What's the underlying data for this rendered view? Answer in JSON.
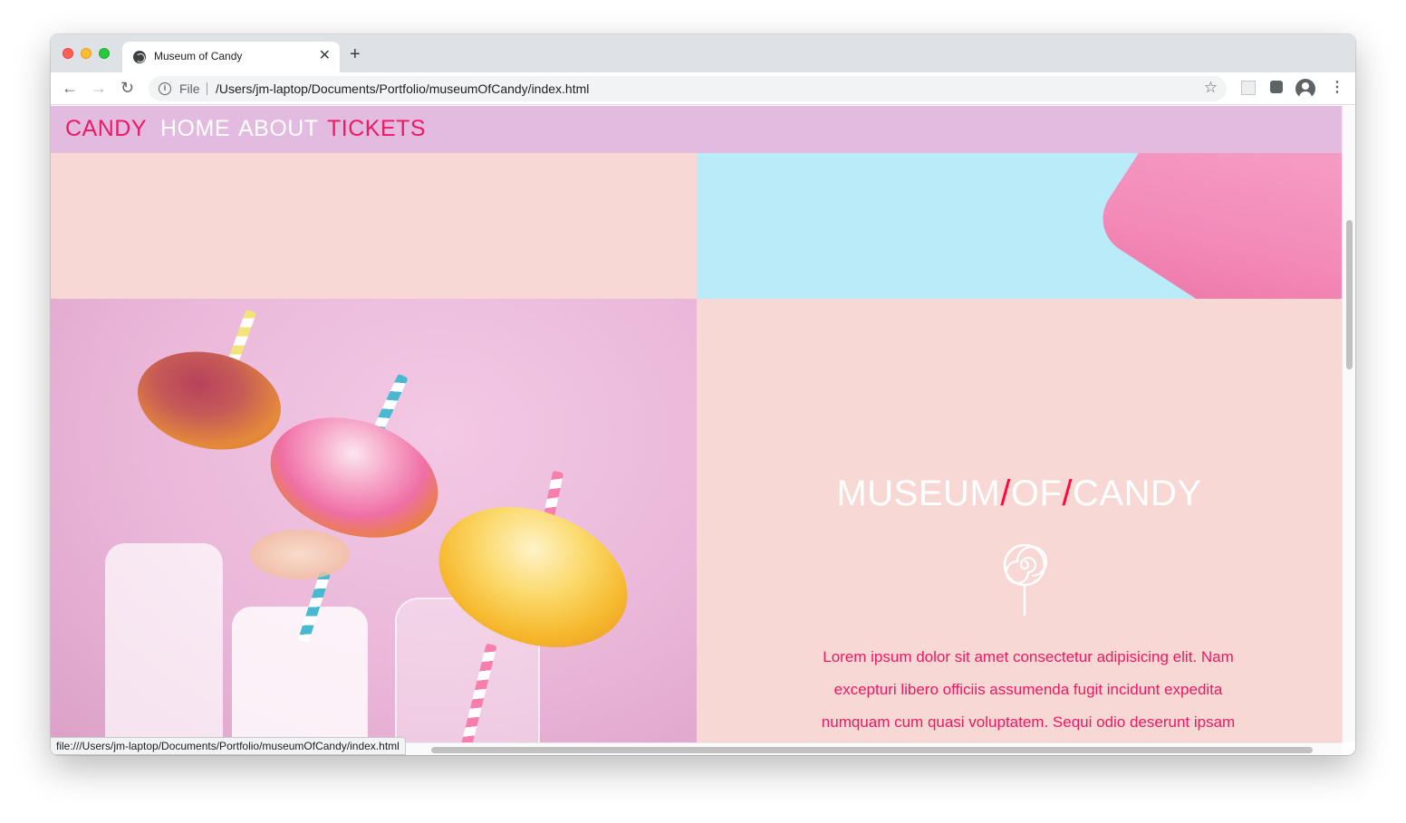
{
  "browser": {
    "tab_title": "Museum of Candy",
    "tab_close": "✕",
    "new_tab": "+",
    "back": "←",
    "forward": "→",
    "reload": "↻",
    "scheme_label": "File",
    "url": "/Users/jm-laptop/Documents/Portfolio/museumOfCandy/index.html",
    "star": "☆",
    "menu": "⋮",
    "status_url": "file:///Users/jm-laptop/Documents/Portfolio/museumOfCandy/index.html"
  },
  "site": {
    "brand": "CANDY",
    "nav": {
      "home": "HOME",
      "about": "ABOUT",
      "tickets": "TICKETS"
    },
    "hero": {
      "title_part1": "MUSEUM",
      "slash": "/",
      "title_part2": "OF",
      "title_part3": "CANDY",
      "lorem": "Lorem ipsum dolor sit amet consectetur adipisicing elit. Nam excepturi libero officiis assumenda fugit incidunt expedita numquam cum quasi voluptatem. Sequi odio deserunt ipsam"
    }
  },
  "colors": {
    "nav_bg": "#e3bbe0",
    "accent": "#ef1862",
    "peach": "#f7d8d4",
    "sky": "#b9ebf8"
  }
}
